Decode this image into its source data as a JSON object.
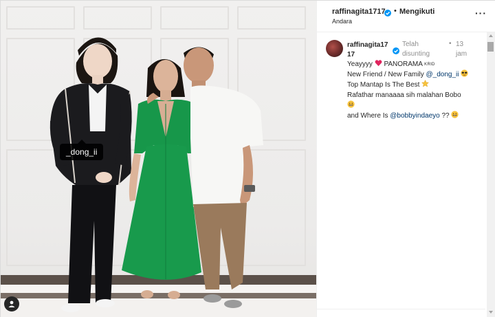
{
  "post": {
    "username": "raffinagita1717",
    "follow_label": "Mengikuti",
    "dot": "•",
    "location": "Andara",
    "more_label": "···",
    "photo_tag": "_dong_ii"
  },
  "caption": {
    "username": "raffinagita1717",
    "edited_label": "Telah disunting",
    "dot": "•",
    "time_ago": "13 jam",
    "line1_a": "Yeayyyy",
    "line1_b": "PANORAMA",
    "line1_c": "KRID",
    "line2_a": "New Friend / New Family",
    "line2_mention": "@_dong_ii",
    "line3": "Top Mantap Is The Best",
    "line4": "Rafathar manaaaa sih malahan Bobo",
    "line6_a": "and Where Is",
    "line6_mention": "@bobbyindaeyo",
    "line6_b": "??"
  },
  "icons": {
    "verified": "verified-badge-icon",
    "heart": "heart-emoji-icon",
    "sunglasses": "sunglasses-emoji-icon",
    "star": "star-emoji-icon",
    "grin": "grinning-emoji-icon",
    "user_tag": "user-tag-icon"
  },
  "colors": {
    "verified": "#0095f6",
    "mention": "#00376b",
    "meta_text": "#8e8e8e",
    "heart": "#e0245e"
  }
}
